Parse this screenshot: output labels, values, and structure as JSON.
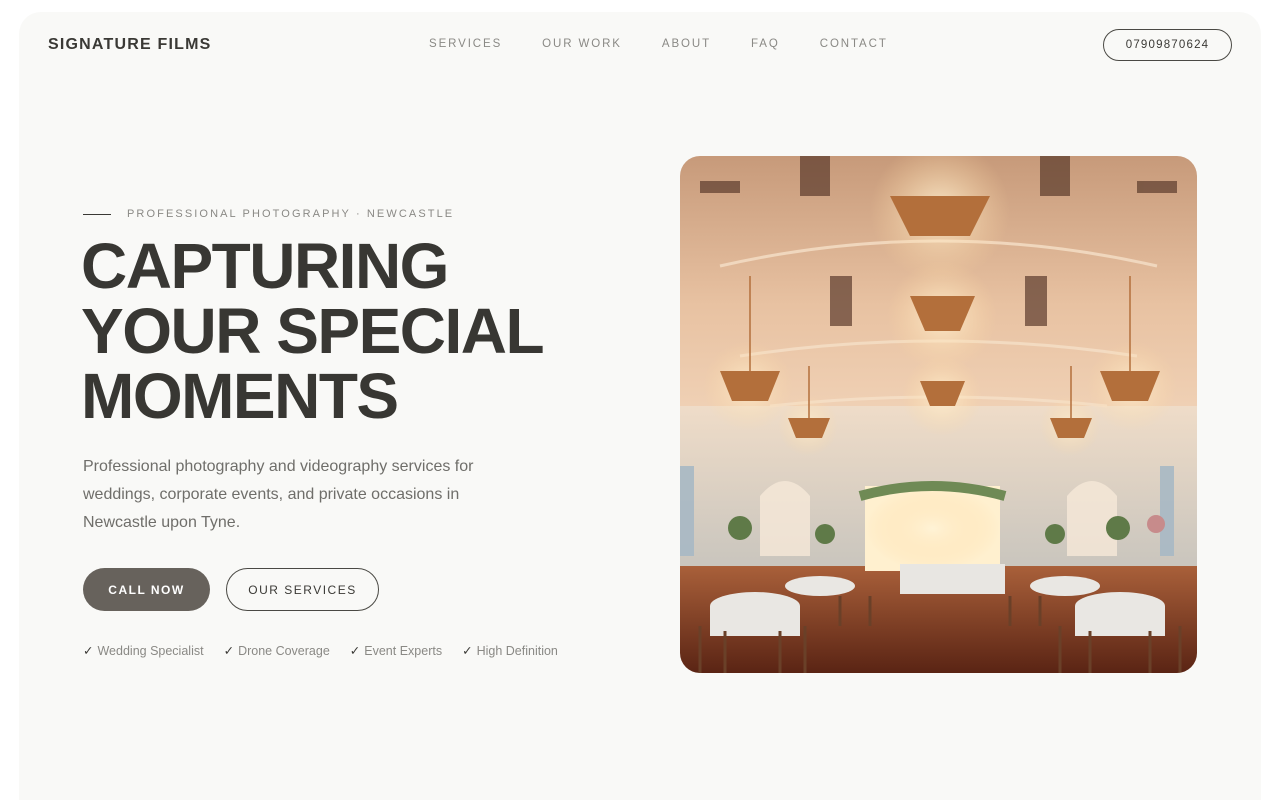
{
  "header": {
    "brand": "SIGNATURE FILMS",
    "nav": [
      "SERVICES",
      "OUR WORK",
      "ABOUT",
      "FAQ",
      "CONTACT"
    ],
    "phone": "07909870624"
  },
  "hero": {
    "eyebrow": "PROFESSIONAL PHOTOGRAPHY · NEWCASTLE",
    "headline": [
      "CAPTURING",
      "YOUR SPECIAL",
      "MOMENTS"
    ],
    "lead": "Professional photography and videography services for weddings, corporate events, and private occasions in Newcastle upon Tyne.",
    "cta_primary": "CALL NOW",
    "cta_secondary": "OUR SERVICES",
    "features": [
      {
        "check": "✓",
        "label": "Wedding Specialist"
      },
      {
        "check": "✓",
        "label": "Drone Coverage"
      },
      {
        "check": "✓",
        "label": "Event Experts"
      },
      {
        "check": "✓",
        "label": "High Definition"
      }
    ],
    "image_subject": "wedding ballroom with chandeliers"
  },
  "colors": {
    "background": "#f9f9f7",
    "text": "#3a3935",
    "muted": "#8a8985",
    "button": "#67625c"
  }
}
